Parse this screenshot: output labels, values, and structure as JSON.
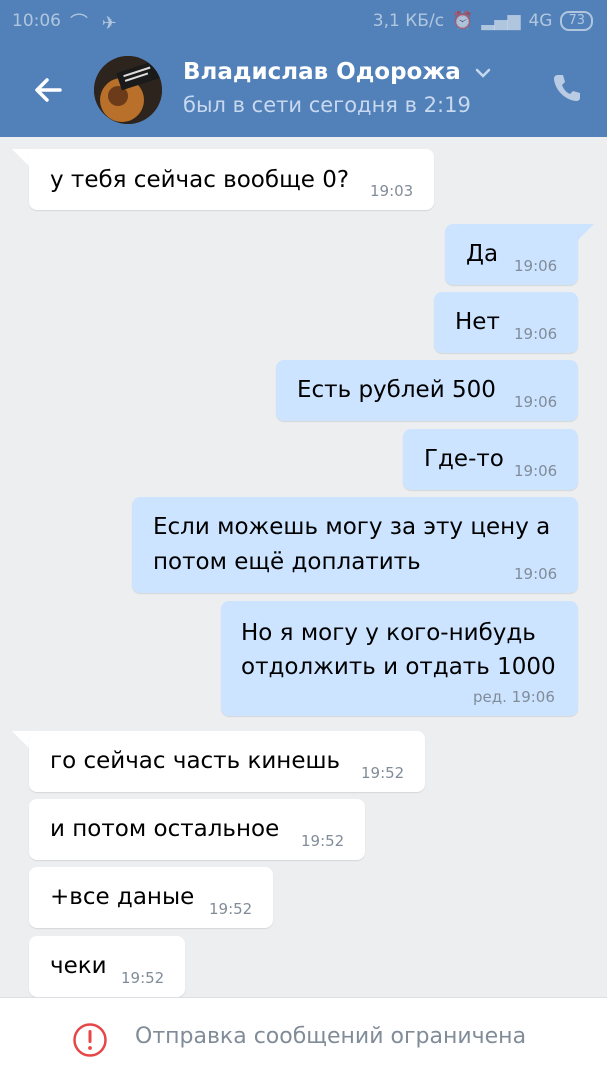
{
  "status_bar": {
    "time": "10:06",
    "speed": "3,1 КБ/с",
    "network": "4G",
    "battery": "73"
  },
  "header": {
    "contact_name": "Владислав Одорожа",
    "last_seen": "был в сети сегодня в 2:19",
    "icons": [
      "back-arrow-icon",
      "chevron-down-icon",
      "phone-icon"
    ]
  },
  "messages": [
    {
      "direction": "in",
      "text": "у тебя сейчас вообще 0?",
      "time": "19:03"
    },
    {
      "direction": "out",
      "text": "Да",
      "time": "19:06"
    },
    {
      "direction": "out",
      "text": "Нет",
      "time": "19:06"
    },
    {
      "direction": "out",
      "text": "Есть рублей 500",
      "time": "19:06"
    },
    {
      "direction": "out",
      "text": "Где-то",
      "time": "19:06"
    },
    {
      "direction": "out",
      "text_lines": [
        "Если можешь могу за эту цену а",
        "потом ещё доплатить"
      ],
      "time": "19:06"
    },
    {
      "direction": "out",
      "text_lines": [
        "Но я могу у кого-нибудь",
        "отдолжить и отдать 1000"
      ],
      "time": "ред. 19:06"
    },
    {
      "direction": "in",
      "text": "го сейчас часть кинешь",
      "time": "19:52"
    },
    {
      "direction": "in",
      "text": "и потом остальное",
      "time": "19:52"
    },
    {
      "direction": "in",
      "text": "+все даные",
      "time": "19:52"
    },
    {
      "direction": "in",
      "text": "чеки",
      "time": "19:52"
    }
  ],
  "footer": {
    "restriction_text": "Отправка сообщений ограничена",
    "icon": "exclamation-circle-icon"
  },
  "colors": {
    "header": "#5181b8",
    "background": "#edeef0",
    "incoming_bubble": "#ffffff",
    "outgoing_bubble": "#cce4ff",
    "warning": "#e64646"
  }
}
